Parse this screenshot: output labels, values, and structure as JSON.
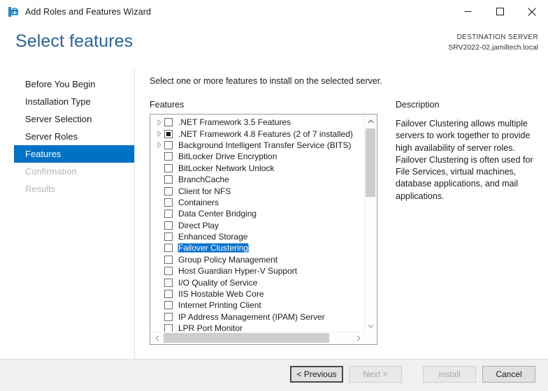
{
  "window": {
    "title": "Add Roles and Features Wizard",
    "icon": "wizard-toolbox-icon",
    "minimize": "minimize-icon",
    "maximize": "maximize-icon",
    "close": "close-icon"
  },
  "header": {
    "page_title": "Select features",
    "destination_label": "DESTINATION SERVER",
    "destination_server": "SRV2022-02.jamiltech.local",
    "title_color": "#2a6496"
  },
  "sidebar": {
    "active_color": "#0072c6",
    "items": [
      {
        "label": "Before You Begin",
        "state": "normal"
      },
      {
        "label": "Installation Type",
        "state": "normal"
      },
      {
        "label": "Server Selection",
        "state": "normal"
      },
      {
        "label": "Server Roles",
        "state": "normal"
      },
      {
        "label": "Features",
        "state": "active"
      },
      {
        "label": "Confirmation",
        "state": "disabled"
      },
      {
        "label": "Results",
        "state": "disabled"
      }
    ]
  },
  "main": {
    "instruction": "Select one or more features to install on the selected server.",
    "features_label": "Features",
    "selection_color": "#0b72cd",
    "features": [
      {
        "label": ".NET Framework 3.5 Features",
        "checkbox": "unchecked",
        "expandable": true,
        "selected": false
      },
      {
        "label": ".NET Framework 4.8 Features (2 of 7 installed)",
        "checkbox": "partial",
        "expandable": true,
        "selected": false
      },
      {
        "label": "Background Intelligent Transfer Service (BITS)",
        "checkbox": "unchecked",
        "expandable": true,
        "selected": false
      },
      {
        "label": "BitLocker Drive Encryption",
        "checkbox": "unchecked",
        "expandable": false,
        "selected": false
      },
      {
        "label": "BitLocker Network Unlock",
        "checkbox": "unchecked",
        "expandable": false,
        "selected": false
      },
      {
        "label": "BranchCache",
        "checkbox": "unchecked",
        "expandable": false,
        "selected": false
      },
      {
        "label": "Client for NFS",
        "checkbox": "unchecked",
        "expandable": false,
        "selected": false
      },
      {
        "label": "Containers",
        "checkbox": "unchecked",
        "expandable": false,
        "selected": false
      },
      {
        "label": "Data Center Bridging",
        "checkbox": "unchecked",
        "expandable": false,
        "selected": false
      },
      {
        "label": "Direct Play",
        "checkbox": "unchecked",
        "expandable": false,
        "selected": false
      },
      {
        "label": "Enhanced Storage",
        "checkbox": "unchecked",
        "expandable": false,
        "selected": false
      },
      {
        "label": "Failover Clustering",
        "checkbox": "unchecked",
        "expandable": false,
        "selected": true
      },
      {
        "label": "Group Policy Management",
        "checkbox": "unchecked",
        "expandable": false,
        "selected": false
      },
      {
        "label": "Host Guardian Hyper-V Support",
        "checkbox": "unchecked",
        "expandable": false,
        "selected": false
      },
      {
        "label": "I/O Quality of Service",
        "checkbox": "unchecked",
        "expandable": false,
        "selected": false
      },
      {
        "label": "IIS Hostable Web Core",
        "checkbox": "unchecked",
        "expandable": false,
        "selected": false
      },
      {
        "label": "Internet Printing Client",
        "checkbox": "unchecked",
        "expandable": false,
        "selected": false
      },
      {
        "label": "IP Address Management (IPAM) Server",
        "checkbox": "unchecked",
        "expandable": false,
        "selected": false
      },
      {
        "label": "LPR Port Monitor",
        "checkbox": "unchecked",
        "expandable": false,
        "selected": false
      }
    ]
  },
  "description": {
    "title": "Description",
    "text": "Failover Clustering allows multiple servers to work together to provide high availability of server roles. Failover Clustering is often used for File Services, virtual machines, database applications, and mail applications."
  },
  "footer": {
    "previous": "< Previous",
    "next": "Next >",
    "install": "Install",
    "cancel": "Cancel",
    "previous_state": "focused",
    "next_state": "disabled",
    "install_state": "disabled",
    "cancel_state": "normal"
  }
}
